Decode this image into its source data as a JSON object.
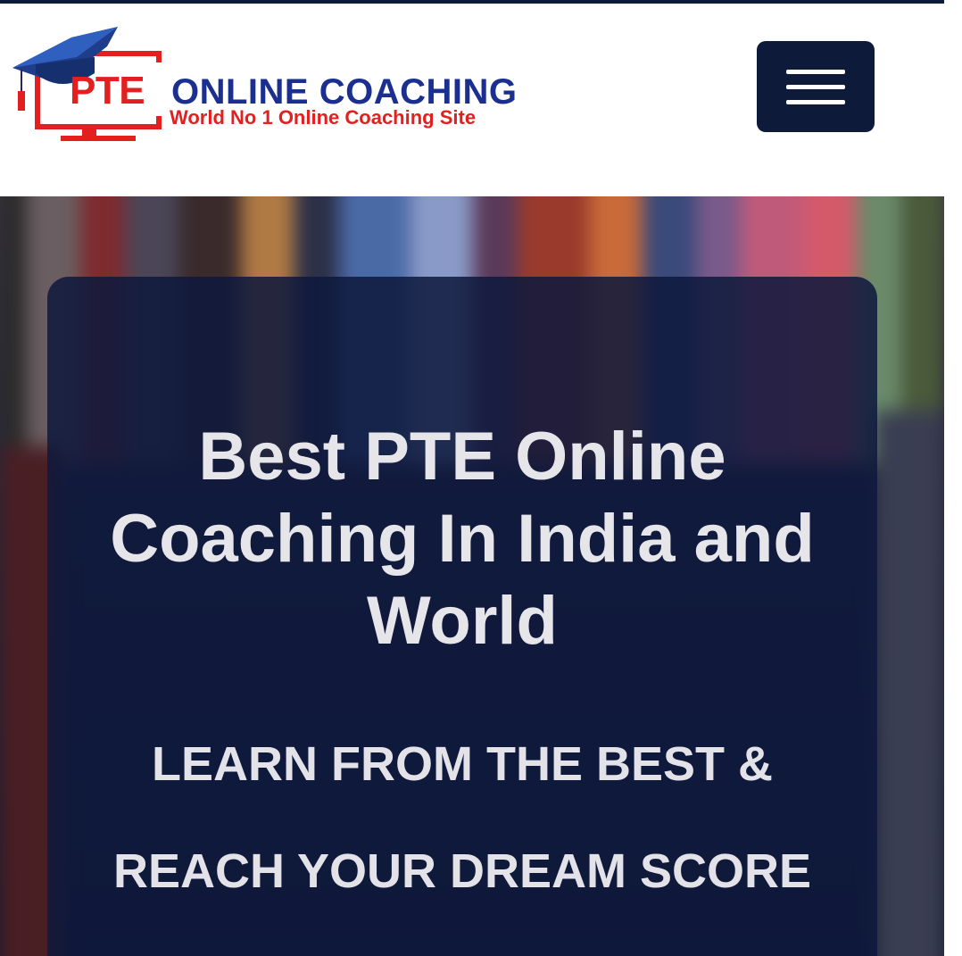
{
  "header": {
    "logo": {
      "brand_red": "PTE",
      "brand_blue": "ONLINE COACHING",
      "tagline": "World No 1 Online Coaching Site",
      "colors": {
        "red": "#e3201f",
        "blue": "#1a2f8f"
      },
      "icons": [
        "graduation-cap-icon",
        "monitor-icon"
      ]
    },
    "menu_button": {
      "icon": "hamburger-menu-icon",
      "background": "#0d1a3a"
    }
  },
  "hero": {
    "title": "Best PTE Online Coaching In India and World",
    "subtitle_line1": "LEARN FROM THE BEST &",
    "subtitle_line2": "REACH YOUR DREAM SCORE",
    "card_color": "#0e183c"
  }
}
